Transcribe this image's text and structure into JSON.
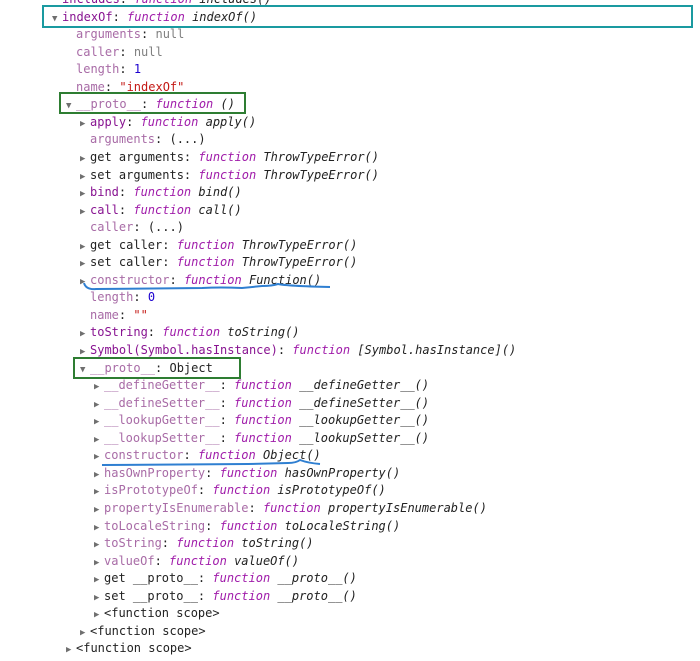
{
  "rows": [
    {
      "indent": 52,
      "tri": "none",
      "key": "includes",
      "keyStyle": "normal",
      "type": "fn",
      "valFn": "function",
      "valName": "includes()"
    },
    {
      "indent": 52,
      "tri": "expanded",
      "key": "indexOf",
      "keyStyle": "normal",
      "type": "fn",
      "valFn": "function",
      "valName": "indexOf()"
    },
    {
      "indent": 66,
      "tri": "none",
      "key": "arguments",
      "keyStyle": "grey",
      "type": "null",
      "val": "null"
    },
    {
      "indent": 66,
      "tri": "none",
      "key": "caller",
      "keyStyle": "grey",
      "type": "null",
      "val": "null"
    },
    {
      "indent": 66,
      "tri": "none",
      "key": "length",
      "keyStyle": "grey",
      "type": "num",
      "val": "1"
    },
    {
      "indent": 66,
      "tri": "none",
      "key": "name",
      "keyStyle": "grey",
      "type": "str",
      "val": "\"indexOf\""
    },
    {
      "indent": 66,
      "tri": "expanded",
      "key": "__proto__",
      "keyStyle": "grey",
      "type": "fn",
      "valFn": "function",
      "valName": "()"
    },
    {
      "indent": 80,
      "tri": "collapsed",
      "key": "apply",
      "keyStyle": "normal",
      "type": "fn",
      "valFn": "function",
      "valName": "apply()"
    },
    {
      "indent": 80,
      "tri": "none",
      "key": "arguments",
      "keyStyle": "grey",
      "type": "plain",
      "val": "(...)"
    },
    {
      "indent": 80,
      "tri": "collapsed",
      "key": "get arguments",
      "keyStyle": "plain",
      "type": "fn",
      "valFn": "function",
      "valName": "ThrowTypeError()"
    },
    {
      "indent": 80,
      "tri": "collapsed",
      "key": "set arguments",
      "keyStyle": "plain",
      "type": "fn",
      "valFn": "function",
      "valName": "ThrowTypeError()"
    },
    {
      "indent": 80,
      "tri": "collapsed",
      "key": "bind",
      "keyStyle": "normal",
      "type": "fn",
      "valFn": "function",
      "valName": "bind()"
    },
    {
      "indent": 80,
      "tri": "collapsed",
      "key": "call",
      "keyStyle": "normal",
      "type": "fn",
      "valFn": "function",
      "valName": "call()"
    },
    {
      "indent": 80,
      "tri": "none",
      "key": "caller",
      "keyStyle": "grey",
      "type": "plain",
      "val": "(...)"
    },
    {
      "indent": 80,
      "tri": "collapsed",
      "key": "get caller",
      "keyStyle": "plain",
      "type": "fn",
      "valFn": "function",
      "valName": "ThrowTypeError()"
    },
    {
      "indent": 80,
      "tri": "collapsed",
      "key": "set caller",
      "keyStyle": "plain",
      "type": "fn",
      "valFn": "function",
      "valName": "ThrowTypeError()"
    },
    {
      "indent": 80,
      "tri": "collapsed",
      "key": "constructor",
      "keyStyle": "grey",
      "type": "fn",
      "valFn": "function",
      "valName": "Function()"
    },
    {
      "indent": 80,
      "tri": "none",
      "key": "length",
      "keyStyle": "grey",
      "type": "num",
      "val": "0"
    },
    {
      "indent": 80,
      "tri": "none",
      "key": "name",
      "keyStyle": "grey",
      "type": "str",
      "val": "\"\""
    },
    {
      "indent": 80,
      "tri": "collapsed",
      "key": "toString",
      "keyStyle": "normal",
      "type": "fn",
      "valFn": "function",
      "valName": "toString()"
    },
    {
      "indent": 80,
      "tri": "collapsed",
      "key": "Symbol(Symbol.hasInstance)",
      "keyStyle": "normal",
      "type": "fn",
      "valFn": "function",
      "valName": "[Symbol.hasInstance]()"
    },
    {
      "indent": 80,
      "tri": "expanded",
      "key": "__proto__",
      "keyStyle": "grey",
      "type": "plain",
      "val": "Object"
    },
    {
      "indent": 94,
      "tri": "collapsed",
      "key": "__defineGetter__",
      "keyStyle": "grey",
      "type": "fn",
      "valFn": "function",
      "valName": "__defineGetter__()"
    },
    {
      "indent": 94,
      "tri": "collapsed",
      "key": "__defineSetter__",
      "keyStyle": "grey",
      "type": "fn",
      "valFn": "function",
      "valName": "__defineSetter__()"
    },
    {
      "indent": 94,
      "tri": "collapsed",
      "key": "__lookupGetter__",
      "keyStyle": "grey",
      "type": "fn",
      "valFn": "function",
      "valName": "__lookupGetter__()"
    },
    {
      "indent": 94,
      "tri": "collapsed",
      "key": "__lookupSetter__",
      "keyStyle": "grey",
      "type": "fn",
      "valFn": "function",
      "valName": "__lookupSetter__()"
    },
    {
      "indent": 94,
      "tri": "collapsed",
      "key": "constructor",
      "keyStyle": "grey",
      "type": "fn",
      "valFn": "function",
      "valName": "Object()"
    },
    {
      "indent": 94,
      "tri": "collapsed",
      "key": "hasOwnProperty",
      "keyStyle": "grey",
      "type": "fn",
      "valFn": "function",
      "valName": "hasOwnProperty()"
    },
    {
      "indent": 94,
      "tri": "collapsed",
      "key": "isPrototypeOf",
      "keyStyle": "grey",
      "type": "fn",
      "valFn": "function",
      "valName": "isPrototypeOf()"
    },
    {
      "indent": 94,
      "tri": "collapsed",
      "key": "propertyIsEnumerable",
      "keyStyle": "grey",
      "type": "fn",
      "valFn": "function",
      "valName": "propertyIsEnumerable()"
    },
    {
      "indent": 94,
      "tri": "collapsed",
      "key": "toLocaleString",
      "keyStyle": "grey",
      "type": "fn",
      "valFn": "function",
      "valName": "toLocaleString()"
    },
    {
      "indent": 94,
      "tri": "collapsed",
      "key": "toString",
      "keyStyle": "grey",
      "type": "fn",
      "valFn": "function",
      "valName": "toString()"
    },
    {
      "indent": 94,
      "tri": "collapsed",
      "key": "valueOf",
      "keyStyle": "grey",
      "type": "fn",
      "valFn": "function",
      "valName": "valueOf()"
    },
    {
      "indent": 94,
      "tri": "collapsed",
      "key": "get __proto__",
      "keyStyle": "plain",
      "type": "fn",
      "valFn": "function",
      "valName": "__proto__()"
    },
    {
      "indent": 94,
      "tri": "collapsed",
      "key": "set __proto__",
      "keyStyle": "plain",
      "type": "fn",
      "valFn": "function",
      "valName": "__proto__()"
    },
    {
      "indent": 94,
      "tri": "collapsed",
      "key": "<function scope>",
      "keyStyle": "plain",
      "type": "none"
    },
    {
      "indent": 80,
      "tri": "collapsed",
      "key": "<function scope>",
      "keyStyle": "plain",
      "type": "none"
    },
    {
      "indent": 66,
      "tri": "collapsed",
      "key": "<function scope>",
      "keyStyle": "plain",
      "type": "none"
    }
  ],
  "separator": ": ",
  "colors": {
    "teal_box": "#1a9aa0",
    "green_box": "#2e7d32",
    "underline": "#2f7fd1",
    "fn_keyword": "#a01caa",
    "key": "#881391",
    "string": "#c41a16",
    "number": "#1c00cf"
  }
}
